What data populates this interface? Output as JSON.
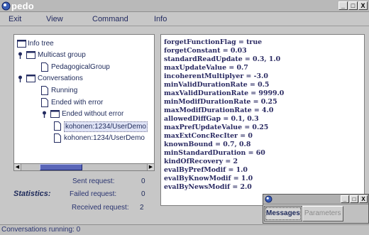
{
  "window": {
    "title": "pedo",
    "minimize": "_",
    "maximize": "□",
    "close": "X"
  },
  "menu": {
    "items": [
      "Exit",
      "View",
      "Command",
      "Info"
    ]
  },
  "tree": {
    "nodes": [
      {
        "label": "Info tree",
        "icon": "folder-icon"
      },
      {
        "label": "Multicast group",
        "icon": "folder-icon"
      },
      {
        "label": "PedagogicalGroup",
        "icon": "document-icon"
      },
      {
        "label": "Conversations",
        "icon": "folder-icon"
      },
      {
        "label": "Running",
        "icon": "document-icon"
      },
      {
        "label": "Ended with error",
        "icon": "document-icon"
      },
      {
        "label": "Ended without error",
        "icon": "folder-icon"
      },
      {
        "label": "kohonen:1234/UserDemo",
        "icon": "document-icon"
      },
      {
        "label": "kohonen:1234/UserDemo",
        "icon": "document-icon"
      }
    ],
    "hscroll_position": 0.22
  },
  "statistics": {
    "label": "Statistics:",
    "sent_label": "Sent request:",
    "sent_value": "0",
    "failed_label": "Failed request:",
    "failed_value": "0",
    "received_label": "Received request:",
    "received_value": "2"
  },
  "params": {
    "lines": [
      "forgetFunctionFlag = true",
      "forgetConstant = 0.03",
      "standardReadUpdate = 0.3, 1.0",
      "maxUpdateValue = 0.7",
      "incoherentMultiplyer = -3.0",
      "minValidDurationRate = 0.5",
      "maxValidDurationRate = 9999.0",
      "minModifDurationRate = 0.25",
      "maxModifDurationRate = 4.0",
      "allowedDiffGap = 0.1, 0.3",
      "maxPrefUpdateValue = 0.25",
      "maxExtConcRecIter = 0",
      "knownBound = 0.7, 0.8",
      "minStandardDuration = 60",
      "kindOfRecovery = 2",
      "evalByPrefModif = 1.0",
      "evalByKnowModif = 1.0",
      "evalByNewsModif = 2.0"
    ]
  },
  "status": {
    "text": "Conversations running: 0"
  },
  "mini_window": {
    "tab_messages": "Messages",
    "tab_parameters": "Parameters",
    "minimize": "_",
    "maximize": "□",
    "close": "X"
  },
  "colors": {
    "title_text": "#ffffff",
    "text": "#1e2a5a",
    "scroll_thumb": "#5a66b8",
    "background": "#c7c7c7"
  }
}
